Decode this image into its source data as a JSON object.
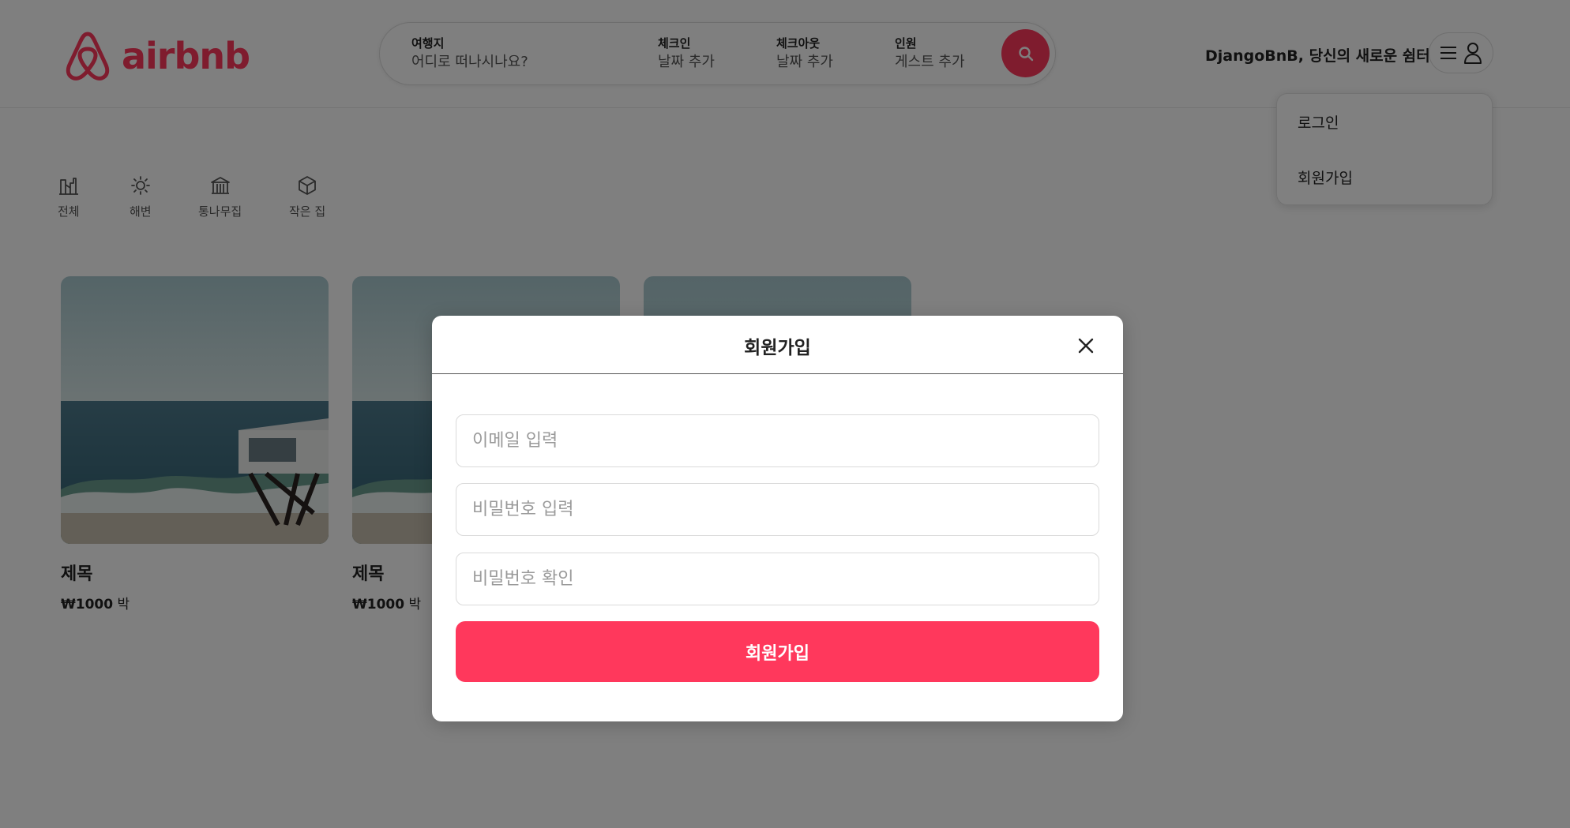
{
  "brand": {
    "name": "airbnb",
    "color": "#ff385c"
  },
  "search": {
    "where_label": "여행지",
    "where_value": "어디로 떠나시나요?",
    "checkin_label": "체크인",
    "checkin_value": "날짜 추가",
    "checkout_label": "체크아웃",
    "checkout_value": "날짜 추가",
    "guests_label": "인원",
    "guests_value": "게스트 추가",
    "button_icon": "search-icon"
  },
  "header": {
    "host_text": "DjangoBnB, 당신의 새로운 쉼터",
    "menu_icons": [
      "menu-icon",
      "user-icon"
    ]
  },
  "user_menu": {
    "items": [
      "로그인",
      "회원가입"
    ]
  },
  "categories": [
    {
      "label": "전체",
      "icon": "city-icon"
    },
    {
      "label": "해변",
      "icon": "sun-icon"
    },
    {
      "label": "통나무집",
      "icon": "cabin-icon"
    },
    {
      "label": "작은 집",
      "icon": "cube-icon"
    }
  ],
  "listings": [
    {
      "title": "제목",
      "price": "₩1000",
      "unit": " 박"
    },
    {
      "title": "제목",
      "price": "₩1000",
      "unit": " 박"
    },
    {
      "title": "",
      "price": "",
      "unit": ""
    }
  ],
  "modal": {
    "title": "회원가입",
    "close_icon": "close-icon",
    "email_placeholder": "이메일 입력",
    "password_placeholder": "비밀번호 입력",
    "confirm_placeholder": "비밀번호 확인",
    "submit_label": "회원가입"
  }
}
